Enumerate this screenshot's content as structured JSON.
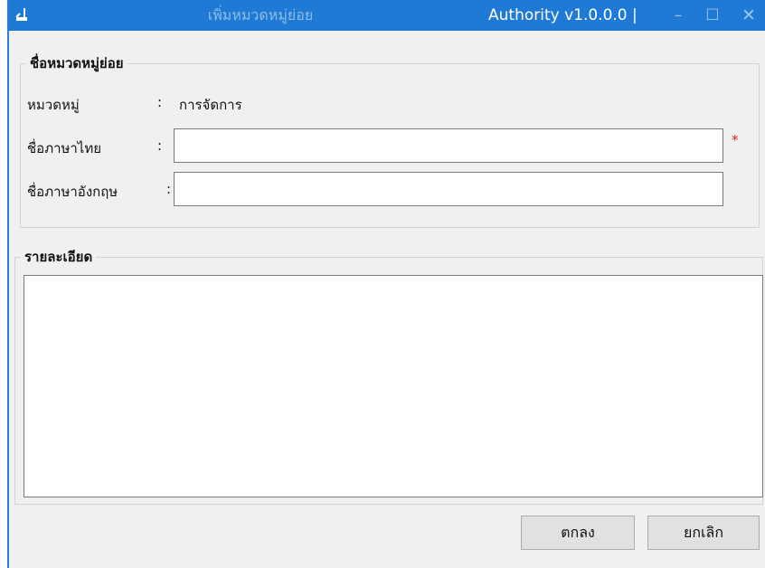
{
  "window": {
    "title": "เพิ่มหมวดหมู่ย่อย",
    "version": "Authority v1.0.0.0 |",
    "minimize_glyph": "–",
    "maximize_glyph": "☐",
    "close_glyph": "✕",
    "icon": "app-logo-icon",
    "accent_color": "#1f7ad6"
  },
  "group": {
    "legend": "ชื่อหมวดหมู่ย่อย",
    "category_label": "หมวดหมู่",
    "category_colon": ":",
    "category_value": "การจัดการ",
    "thai_name_label": "ชื่อภาษาไทย",
    "thai_name_colon": ":",
    "thai_name_value": "",
    "required_mark": "*",
    "english_name_label": "ชื่อภาษาอังกฤษ",
    "english_name_colon": ":",
    "english_name_value": ""
  },
  "detail": {
    "legend": "รายละเอียด",
    "value": ""
  },
  "buttons": {
    "ok_label": "ตกลง",
    "cancel_label": "ยกเลิก"
  }
}
